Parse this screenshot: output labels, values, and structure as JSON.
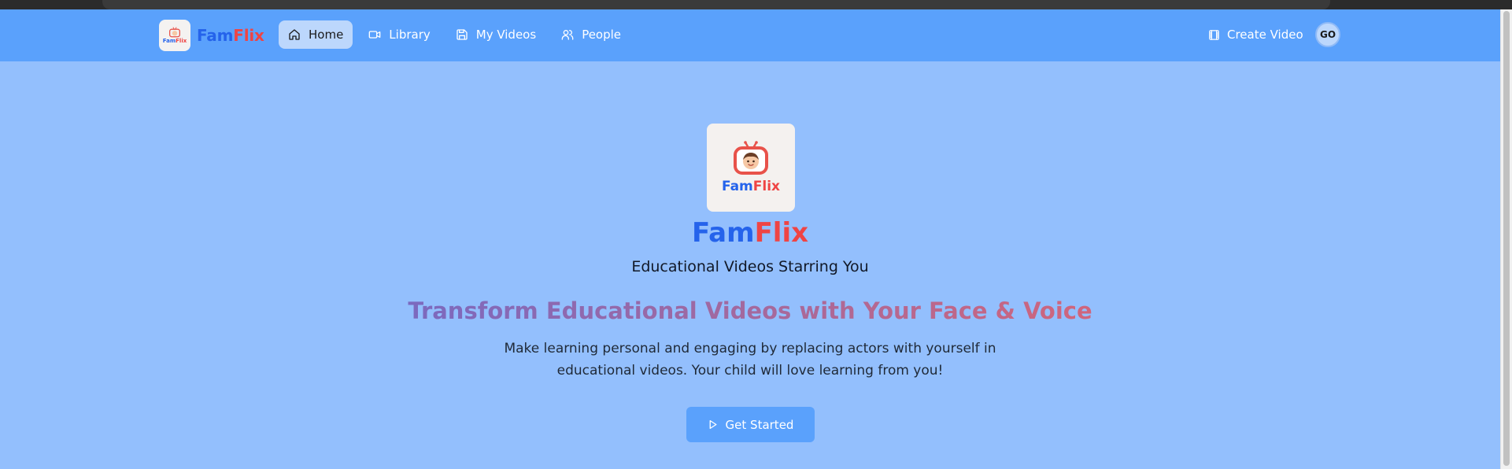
{
  "navbar": {
    "brand": {
      "fam": "Fam",
      "flix": "Flix",
      "logo_text_fam": "Fam",
      "logo_text_flix": "Flix"
    },
    "links": [
      {
        "label": "Home",
        "icon": "home-icon",
        "active": true
      },
      {
        "label": "Library",
        "icon": "video-camera-icon",
        "active": false
      },
      {
        "label": "My Videos",
        "icon": "save-icon",
        "active": false
      },
      {
        "label": "People",
        "icon": "users-icon",
        "active": false
      }
    ],
    "create_video": {
      "label": "Create Video",
      "icon": "film-icon"
    },
    "avatar": {
      "initials": "GO"
    }
  },
  "hero": {
    "logo": {
      "fam": "Fam",
      "flix": "Flix",
      "icon": "tv-kid-icon"
    },
    "title": {
      "fam": "Fam",
      "flix": "Flix"
    },
    "subtitle": "Educational Videos Starring You",
    "headline": "Transform Educational Videos with Your Face & Voice",
    "description_line1": "Make learning personal and engaging by replacing actors with yourself in",
    "description_line2": "educational videos. Your child will love learning from you!",
    "cta": {
      "label": "Get Started",
      "icon": "play-icon"
    }
  },
  "colors": {
    "nav_bg": "#5aa1fc",
    "page_bg": "#93bffd",
    "brand_blue": "#2563eb",
    "brand_red": "#ef4444",
    "headline_gradient_start": "#7b69bf",
    "headline_gradient_end": "#d0657c"
  }
}
